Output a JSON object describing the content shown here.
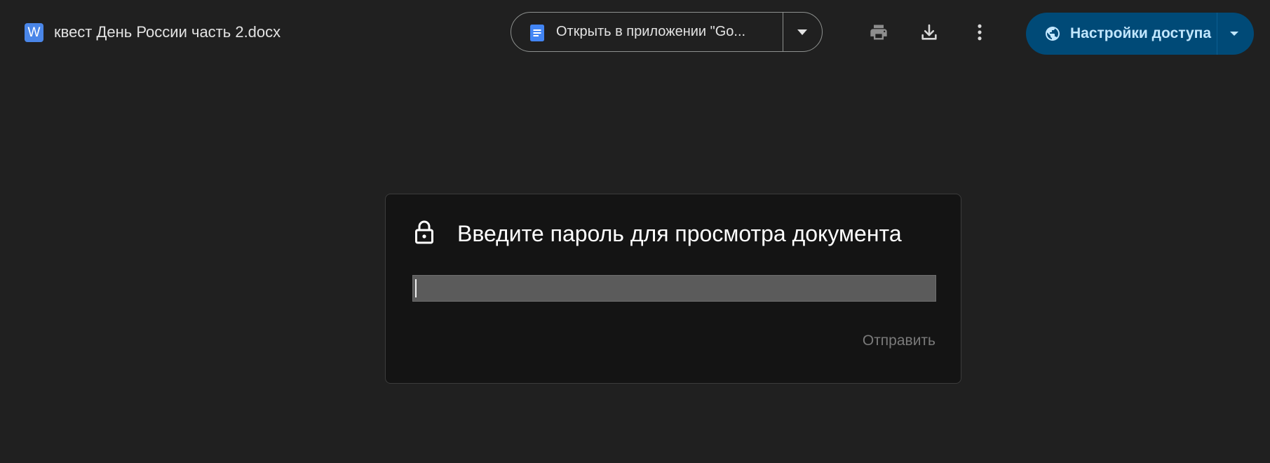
{
  "header": {
    "file_icon_letter": "W",
    "file_icon_color": "#4a86e8",
    "file_name": "квест День России часть 2.docx",
    "open_with": {
      "label": "Открыть в приложении \"Go...",
      "icon": "google-docs-icon",
      "dropdown_icon": "caret-down-icon"
    },
    "toolbar_icons": [
      "print-icon",
      "download-icon",
      "more-vert-icon"
    ],
    "share": {
      "label": "Настройки доступа",
      "icon": "globe-icon",
      "dropdown_icon": "caret-down-icon",
      "background_color": "#004a77",
      "text_color": "#c2e7ff"
    }
  },
  "dialog": {
    "icon": "lock-icon",
    "title": "Введите пароль для просмотра документа",
    "password_value": "",
    "submit_label": "Отправить"
  }
}
